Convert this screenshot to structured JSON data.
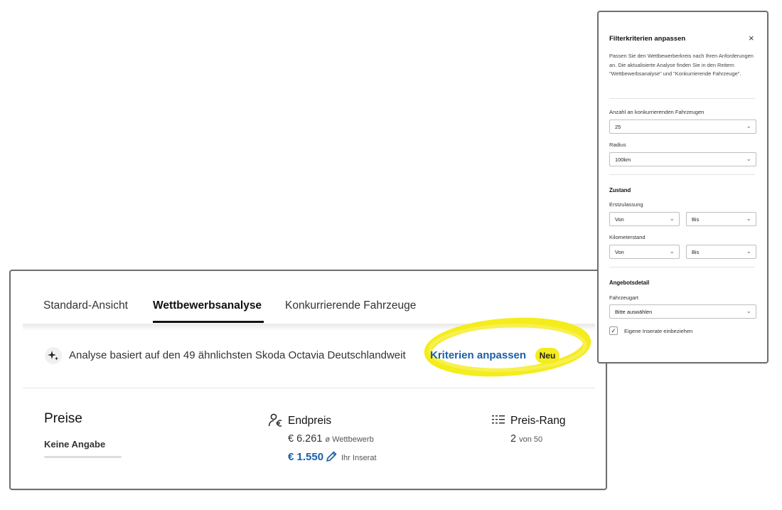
{
  "tabs": [
    {
      "label": "Standard-Ansicht"
    },
    {
      "label": "Wettbewerbsanalyse"
    },
    {
      "label": "Konkurrierende Fahrzeuge"
    }
  ],
  "info": {
    "text": "Analyse basiert auf den 49 ähnlichsten Skoda Octavia Deutschlandweit",
    "link": "Kriterien anpassen",
    "badge": "Neu"
  },
  "prices": {
    "title": "Preise",
    "keine_angabe": "Keine Angabe",
    "endpreis": {
      "title": "Endpreis",
      "competitor_value": "€ 6.261",
      "competitor_label": "ø Wettbewerb",
      "own_value": "€ 1.550",
      "own_label": "Ihr Inserat"
    },
    "rang": {
      "title": "Preis-Rang",
      "value": "2",
      "of_label": "von 50"
    }
  },
  "filter_panel": {
    "title": "Filterkriterien anpassen",
    "close": "×",
    "description": "Passen Sie den Wettbewerberkreis nach Ihren Anforderungen an. Die aktualisierte Analyse finden Sie in den Reitern \"Wettbewerbsanalyse\" und \"Konkurrierende Fahrzeuge\".",
    "count_label": "Anzahl an konkurrierenden Fahrzeugen",
    "count_value": "25",
    "radius_label": "Radius",
    "radius_value": "100km",
    "zustand": "Zustand",
    "erstzulassung_label": "Erstzulassung",
    "erstzulassung_von": "Von",
    "erstzulassung_bis": "Bis",
    "kilometer_label": "Kilometerstand",
    "kilometer_von": "Von",
    "kilometer_bis": "Bis",
    "angebotsdetail": "Angebotsdetail",
    "fahrzeugart_label": "Fahrzeugart",
    "fahrzeugart_value": "Bitte auswählen",
    "own_listings_label": "Eigene Inserate einbeziehen",
    "own_listings_checked": true
  },
  "colors": {
    "link": "#1a5fa8",
    "highlight": "#f5ec1c",
    "badge": "#f5ec1c"
  }
}
